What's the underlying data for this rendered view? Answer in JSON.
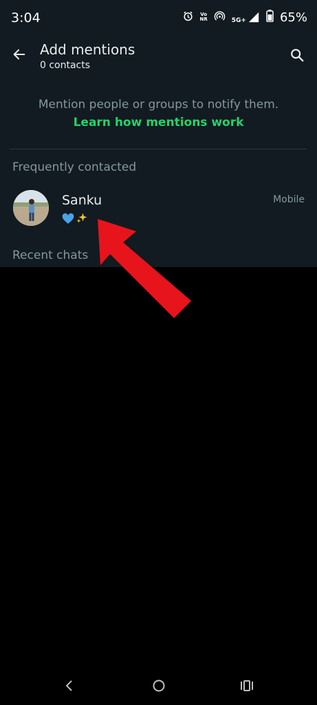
{
  "status_bar": {
    "time": "3:04",
    "volte_top": "Vo",
    "volte_bottom": "NR",
    "network": "5G+",
    "battery": "65%"
  },
  "header": {
    "title": "Add mentions",
    "subtitle": "0 contacts",
    "back_icon": "arrow-left-icon",
    "search_icon": "search-icon"
  },
  "info": {
    "text": "Mention people or groups to notify them.",
    "link": "Learn how mentions work"
  },
  "sections": {
    "frequent": "Frequently contacted",
    "recent": "Recent chats"
  },
  "contacts": [
    {
      "name": "Sanku",
      "status": "💙✨",
      "type": "Mobile"
    }
  ],
  "colors": {
    "background": "#111b21",
    "accent": "#25d366",
    "secondary_text": "#8696a0",
    "annotation": "#e8141b"
  }
}
